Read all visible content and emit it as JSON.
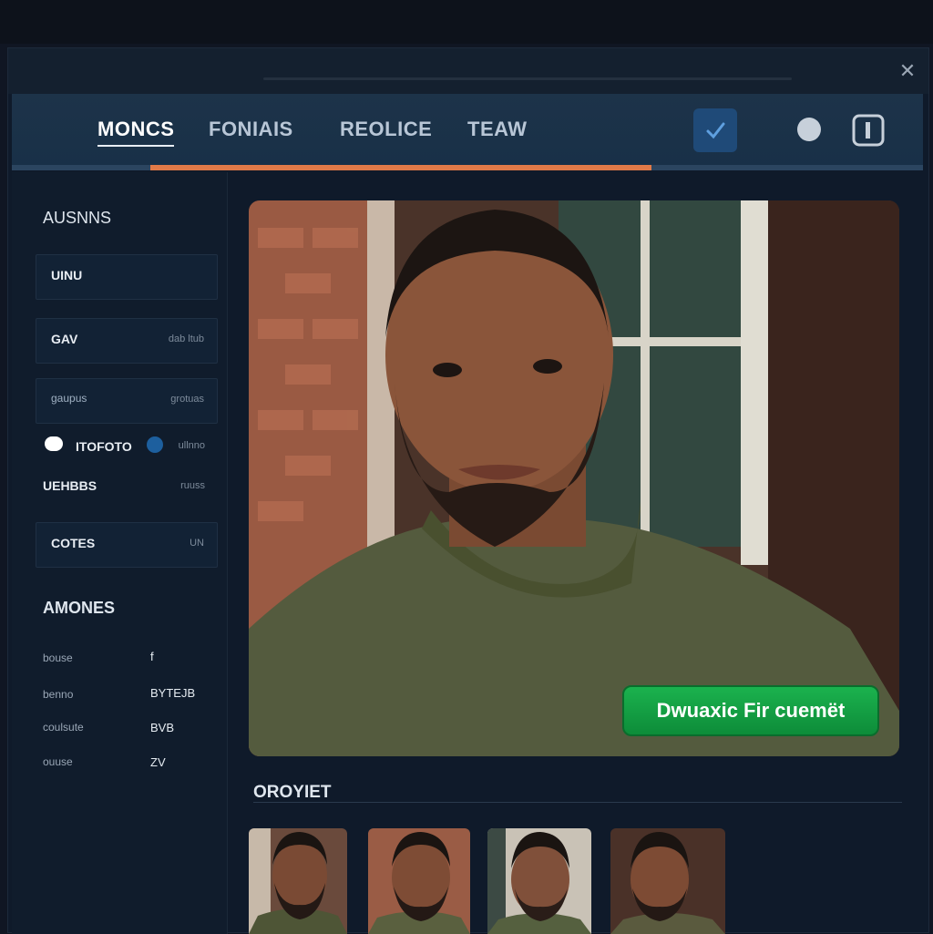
{
  "window": {
    "close_label": "✕"
  },
  "nav": {
    "tabs": [
      {
        "label": "MONCS",
        "active": true
      },
      {
        "label": "FONIAIS",
        "active": false
      },
      {
        "label": "REOLICE",
        "active": false
      },
      {
        "label": "TEAW",
        "active": false
      }
    ],
    "progress_fraction": 0.55,
    "icons": [
      "check-icon",
      "circle-icon",
      "exit-icon"
    ]
  },
  "sidebar": {
    "heading": "AUSNNS",
    "items": [
      {
        "label": "UINU",
        "meta": ""
      },
      {
        "label": "GAV",
        "meta": "dab ltub"
      },
      {
        "label": "gaupus",
        "meta": "grotuas"
      },
      {
        "label": "ITOFOTO",
        "meta": "ullnno"
      },
      {
        "label": "UEHBBS",
        "meta": "ruuss"
      },
      {
        "label": "COTES",
        "meta": "UN"
      }
    ],
    "subheading": "AMONES",
    "details": [
      {
        "label": "bouse",
        "value": "f"
      },
      {
        "label": "benno",
        "value": "BYTEJB"
      },
      {
        "label": "coulsute",
        "value": "BVB"
      },
      {
        "label": "ouuse",
        "value": "ZV"
      }
    ]
  },
  "main": {
    "cta_label": "Dwuaxic Fir cuemët",
    "section_title": "OROYIET"
  },
  "colors": {
    "accent_orange": "#e07a48",
    "cta_green": "#14a045",
    "nav_bg": "#1d3349",
    "window_bg": "#0f1a2a"
  }
}
